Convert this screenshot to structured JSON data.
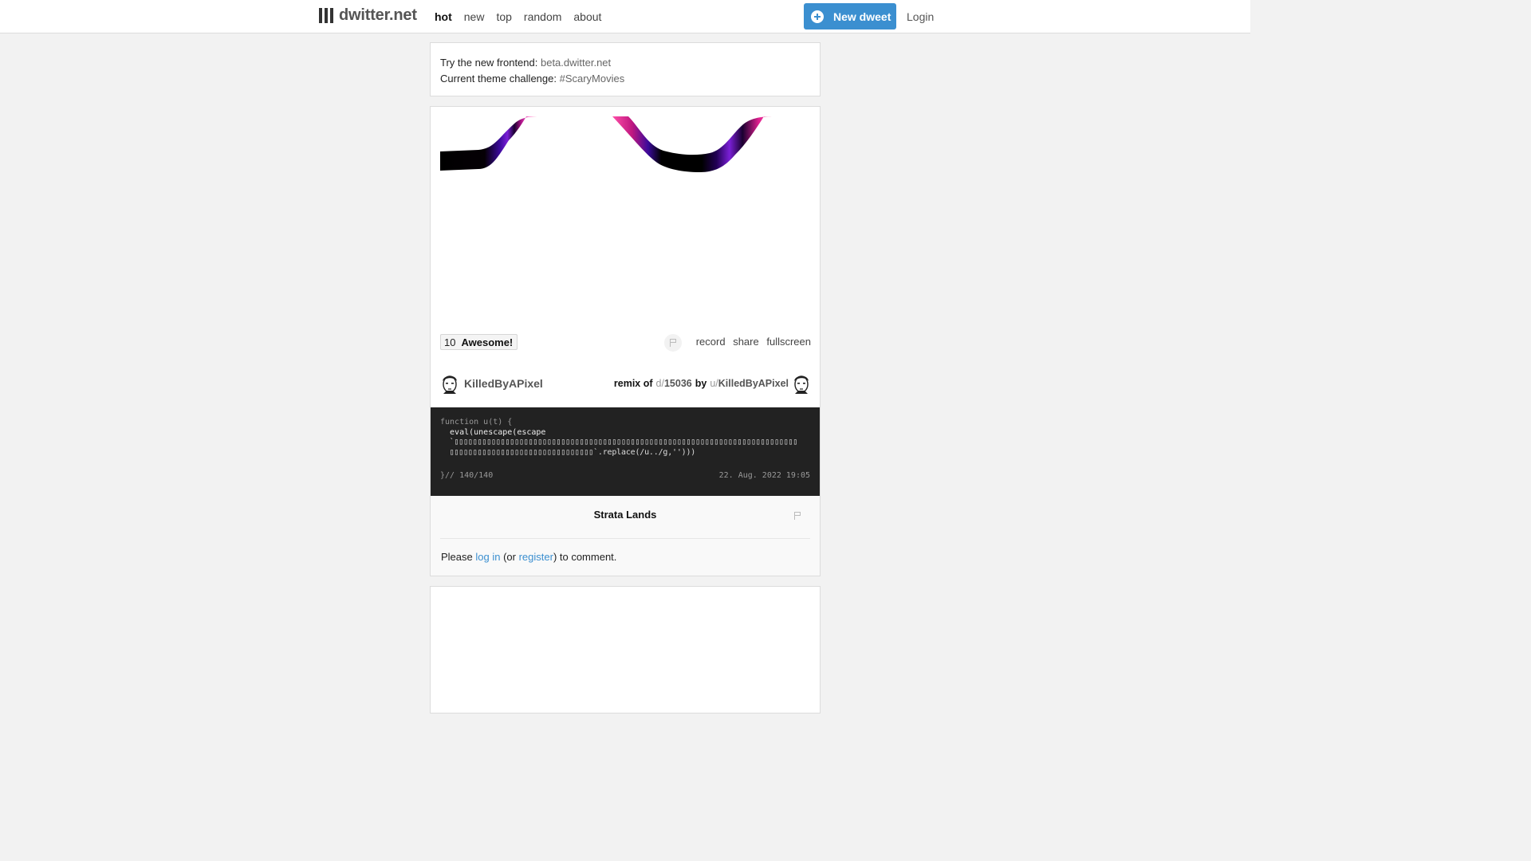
{
  "header": {
    "logo_text": "dwitter.net",
    "nav": [
      {
        "label": "hot",
        "active": true
      },
      {
        "label": "new",
        "active": false
      },
      {
        "label": "top",
        "active": false
      },
      {
        "label": "random",
        "active": false
      },
      {
        "label": "about",
        "active": false
      }
    ],
    "new_dweet_label": "New dweet",
    "login_label": "Login"
  },
  "notice": {
    "line1_prefix": "Try the new frontend: ",
    "line1_link": "beta.dwitter.net",
    "line2_prefix": "Current theme challenge: ",
    "line2_link": "#ScaryMovies"
  },
  "dweet": {
    "vote_count": "10",
    "vote_label": "Awesome!",
    "actions": [
      "record",
      "share",
      "fullscreen"
    ],
    "author": "KilledByAPixel",
    "remix_label": "remix of",
    "remix_prefix": "d/",
    "remix_id": "15036",
    "remix_by": "by",
    "remix_user_prefix": "u/",
    "remix_user": "KilledByAPixel",
    "code": {
      "line1": "function u(t) {",
      "line2": "  eval(unescape(escape",
      "line3_glyphs": "  `▯▯▯▯▯▯▯▯▯▯▯▯▯▯▯▯▯▯▯▯▯▯▯▯▯▯▯▯▯▯▯▯▯▯▯▯▯▯▯▯▯▯▯▯▯▯▯▯▯▯▯▯▯▯▯▯▯▯▯▯▯▯▯▯▯▯▯▯▯▯▯▯▯▯",
      "line4_glyphs": "  ▯▯▯▯▯▯▯▯▯▯▯▯▯▯▯▯▯▯▯▯▯▯▯▯▯▯▯▯▯▯▯`.replace(/u../g,'')))",
      "char_count": "}// 140/140",
      "date": "22. Aug. 2022 19:05"
    },
    "comment_title": "Strata Lands",
    "comment_prompt_prefix": "Please ",
    "comment_login": "log in",
    "comment_middle": " (or ",
    "comment_register": "register",
    "comment_suffix": ") to comment."
  },
  "colors": {
    "accent": "#3b8fd0",
    "stroke_pink": "#ff4fa8",
    "stroke_purple": "#7a1fd6"
  }
}
